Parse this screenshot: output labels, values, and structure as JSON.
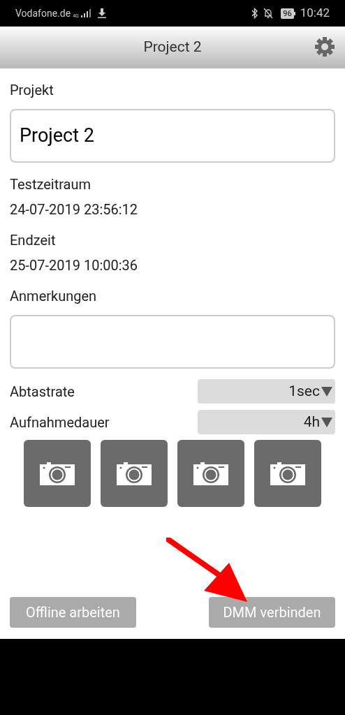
{
  "status_bar": {
    "carrier": "Vodafone.de",
    "network": "4G",
    "battery": "96",
    "time": "10:42"
  },
  "header": {
    "title": "Project 2"
  },
  "form": {
    "project_label": "Projekt",
    "project_value": "Project 2",
    "test_period_label": "Testzeitraum",
    "test_period_value": "24-07-2019 23:56:12",
    "end_label": "Endzeit",
    "end_value": "25-07-2019 10:00:36",
    "notes_label": "Anmerkungen",
    "selects": [
      {
        "label": "Abtastrate",
        "value": "1sec"
      },
      {
        "label": "Aufnahmedauer",
        "value": "4h"
      }
    ],
    "photo_buttons": [
      {
        "kind": "camera"
      },
      {
        "kind": "camera"
      },
      {
        "kind": "camera"
      },
      {
        "kind": "camera"
      }
    ]
  },
  "buttons": [
    "Offline arbeiten",
    "DMM verbinden"
  ]
}
